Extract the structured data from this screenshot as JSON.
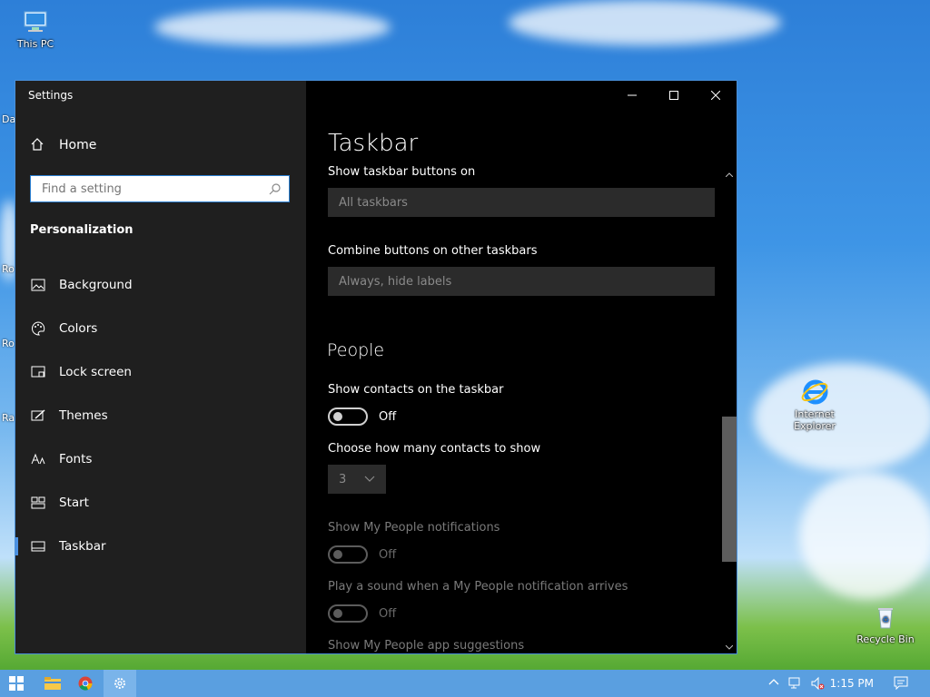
{
  "desktop": {
    "icons": [
      {
        "label": "This PC",
        "icon": "computer-icon"
      },
      {
        "label": "Internet Explorer",
        "icon": "internet-explorer-icon"
      },
      {
        "label": "Recycle Bin",
        "icon": "recycle-bin-icon"
      }
    ],
    "edge_fragments": [
      "Da",
      "Ro",
      "Ro",
      "Ra"
    ]
  },
  "window": {
    "title": "Settings",
    "caption_buttons": [
      "minimize",
      "maximize",
      "close"
    ]
  },
  "sidebar": {
    "home_label": "Home",
    "search_placeholder": "Find a setting",
    "section_title": "Personalization",
    "items": [
      {
        "label": "Background",
        "icon": "image-icon"
      },
      {
        "label": "Colors",
        "icon": "palette-icon"
      },
      {
        "label": "Lock screen",
        "icon": "lock-screen-icon"
      },
      {
        "label": "Themes",
        "icon": "themes-icon"
      },
      {
        "label": "Fonts",
        "icon": "fonts-icon"
      },
      {
        "label": "Start",
        "icon": "start-icon"
      },
      {
        "label": "Taskbar",
        "icon": "taskbar-icon",
        "active": true
      }
    ]
  },
  "main": {
    "page_title": "Taskbar",
    "show_buttons_label": "Show taskbar buttons on",
    "show_buttons_value": "All taskbars",
    "combine_label": "Combine buttons on other taskbars",
    "combine_value": "Always, hide labels",
    "people_title": "People",
    "show_contacts_label": "Show contacts on the taskbar",
    "show_contacts_state": "Off",
    "contacts_count_label": "Choose how many contacts to show",
    "contacts_count_value": "3",
    "notifications_label": "Show My People notifications",
    "notifications_state": "Off",
    "sound_label": "Play a sound when a My People notification arrives",
    "sound_state": "Off",
    "suggestions_label": "Show My People app suggestions"
  },
  "taskbar": {
    "clock": "1:15 PM",
    "accent": "#5a9fe0"
  }
}
